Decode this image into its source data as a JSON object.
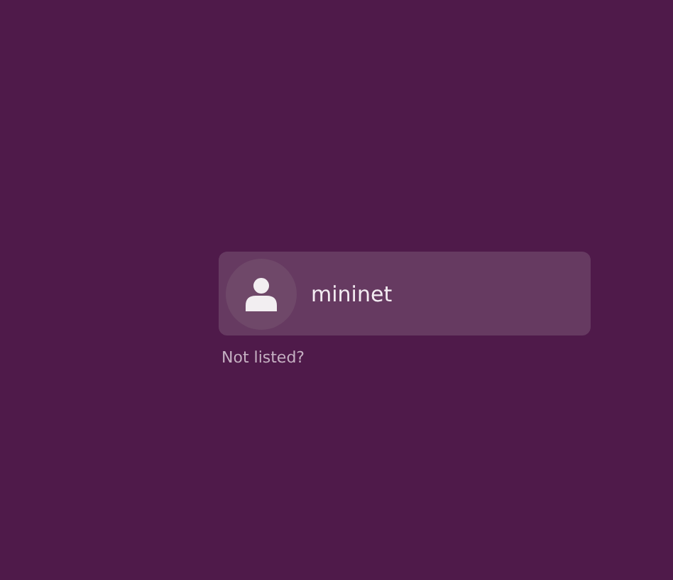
{
  "users": [
    {
      "name": "mininet",
      "selected": true
    }
  ],
  "not_listed_link": "Not listed?"
}
